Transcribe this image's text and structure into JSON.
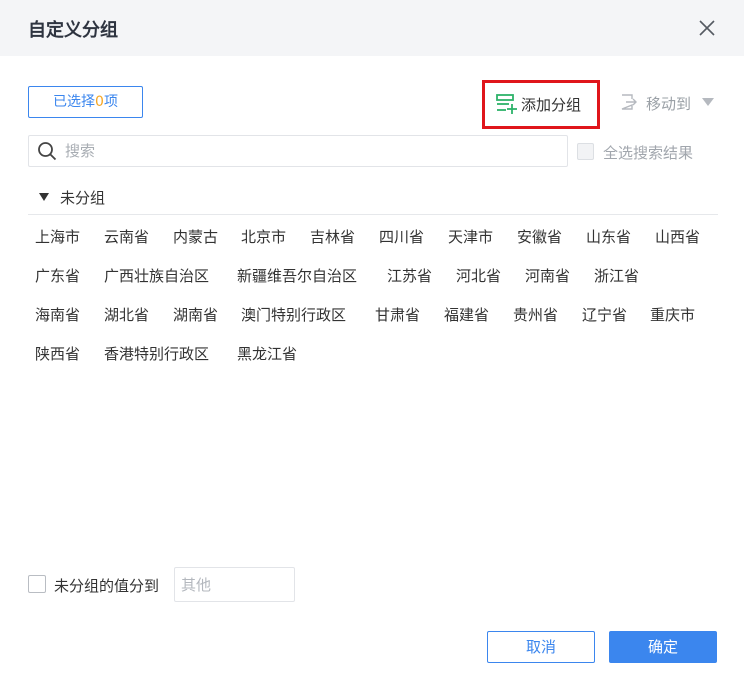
{
  "dialog": {
    "title": "自定义分组",
    "close_icon": "close-icon"
  },
  "toolbar": {
    "selected_prefix": "已选择",
    "selected_count": "0",
    "selected_suffix": "项",
    "add_group_label": "添加分组",
    "add_group_icon": "add-group-icon",
    "move_to_label": "移动到",
    "move_to_icon": "move-to-icon"
  },
  "search": {
    "placeholder": "搜索",
    "value": "",
    "select_all_label": "全选搜索结果",
    "select_all_checked": false
  },
  "group": {
    "name": "未分组",
    "expanded": true,
    "items": [
      [
        "上海市",
        "云南省",
        "内蒙古",
        "北京市",
        "吉林省",
        "四川省",
        "天津市",
        "安徽省",
        "山东省",
        "山西省"
      ],
      [
        "广东省",
        "广西壮族自治区",
        "新疆维吾尔自治区",
        "江苏省",
        "河北省",
        "河南省",
        "浙江省"
      ],
      [
        "海南省",
        "湖北省",
        "湖南省",
        "澳门特别行政区",
        "甘肃省",
        "福建省",
        "贵州省",
        "辽宁省",
        "重庆市"
      ],
      [
        "陕西省",
        "香港特别行政区",
        "黑龙江省"
      ]
    ]
  },
  "footer": {
    "ungrouped_label": "未分组的值分到",
    "ungrouped_checked": false,
    "other_placeholder": "其他",
    "cancel_label": "取消",
    "ok_label": "确定"
  },
  "colors": {
    "accent": "#3b86ee",
    "count_highlight": "#f5a623",
    "add_group_icon": "#2db36a",
    "highlight_box": "#e0151b"
  }
}
